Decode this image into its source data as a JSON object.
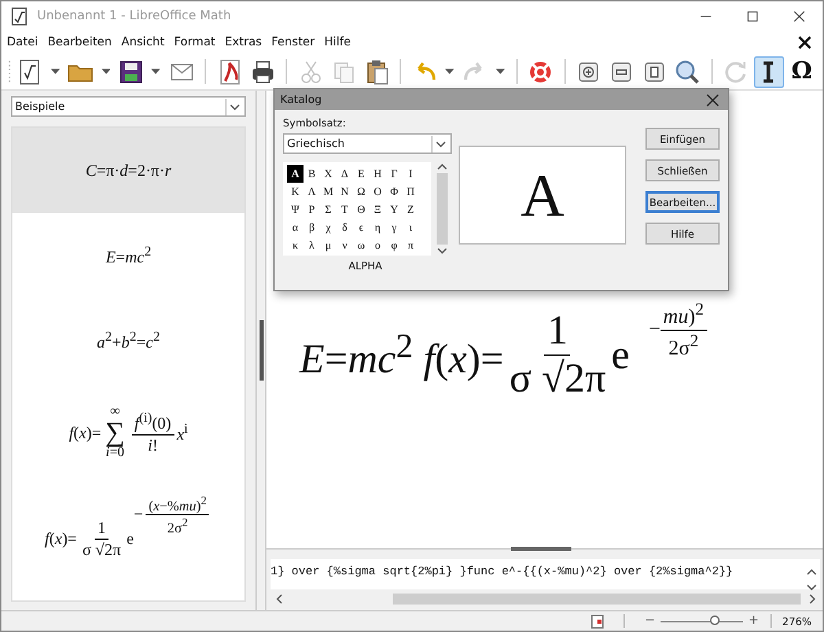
{
  "window": {
    "title": "Unbenannt 1 - LibreOffice Math"
  },
  "menu": [
    {
      "label": "Datei"
    },
    {
      "label": "Bearbeiten"
    },
    {
      "label": "Ansicht"
    },
    {
      "label": "Format"
    },
    {
      "label": "Extras"
    },
    {
      "label": "Fenster"
    },
    {
      "label": "Hilfe"
    }
  ],
  "toolbar": [
    [
      {
        "kind": "new",
        "menu": true,
        "disabled": false,
        "on": false
      },
      {
        "kind": "open",
        "menu": true,
        "disabled": false,
        "on": false
      },
      {
        "kind": "save",
        "menu": true,
        "disabled": false,
        "on": false
      },
      {
        "kind": "mail",
        "menu": false,
        "disabled": false,
        "on": false
      }
    ],
    [
      {
        "kind": "pdf",
        "menu": false,
        "disabled": false,
        "on": false
      },
      {
        "kind": "print",
        "menu": false,
        "disabled": false,
        "on": false
      }
    ],
    [
      {
        "kind": "cut",
        "menu": false,
        "disabled": true,
        "on": false
      },
      {
        "kind": "copy",
        "menu": false,
        "disabled": true,
        "on": false
      },
      {
        "kind": "paste",
        "menu": false,
        "disabled": false,
        "on": false
      }
    ],
    [
      {
        "kind": "undo",
        "menu": true,
        "disabled": false,
        "on": false
      },
      {
        "kind": "redo",
        "menu": true,
        "disabled": true,
        "on": false
      }
    ],
    [
      {
        "kind": "help",
        "menu": false,
        "disabled": false,
        "on": false
      }
    ],
    [
      {
        "kind": "zoom_in",
        "menu": false,
        "disabled": false,
        "on": false
      },
      {
        "kind": "zoom_out",
        "menu": false,
        "disabled": false,
        "on": false
      },
      {
        "kind": "zoom_page",
        "menu": false,
        "disabled": false,
        "on": false
      },
      {
        "kind": "show_all",
        "menu": false,
        "disabled": false,
        "on": false
      }
    ],
    [
      {
        "kind": "update",
        "menu": false,
        "disabled": true,
        "on": false
      },
      {
        "kind": "cursor",
        "menu": false,
        "disabled": false,
        "on": true
      },
      {
        "kind": "symbols",
        "menu": false,
        "disabled": false,
        "on": false,
        "label": "Ω"
      }
    ]
  ],
  "sidebar": {
    "dropdown": {
      "value": "Beispiele"
    },
    "items": [
      {
        "kind": "inline",
        "selected": true,
        "text": "*C*=π·*d*=2·π·*r*"
      },
      {
        "kind": "inline",
        "selected": false,
        "text": "*E*=*mc*$^{2}$"
      },
      {
        "kind": "inline",
        "selected": false,
        "text": "*a*$^{2}$+*b*$^{2}$=*c*$^{2}$"
      },
      {
        "kind": "series",
        "selected": false,
        "lhs": "*f*(*x*)=",
        "upper": "∞",
        "operator": "∑",
        "lower": "*i*=0",
        "numerator": "*f*$^{(i)}$(0)",
        "denominator": "*i*!",
        "tail": "*x*$^{i}$"
      },
      {
        "kind": "gauss",
        "selected": false,
        "lhs": "*f*(*x*)=",
        "numerator": "1",
        "denominator": "σ √2π",
        "base": "e",
        "exponent_sign": "−",
        "exponent_numerator": "(*x*−%*mu*)$^{2}$",
        "exponent_denominator": "2σ$^{2}$"
      }
    ]
  },
  "document": {
    "lhs": "*E*=*mc*$^{2}$ *f*(*x*)=",
    "numerator": "1",
    "denominator": "σ √2π",
    "base": "e",
    "exponent_sign": "−",
    "exponent_numerator": "*mu*)$^{2}$",
    "exponent_denominator": "2σ$^{2}$"
  },
  "dialog": {
    "title": "Katalog",
    "set_label": "Symbolsatz:",
    "set_value": "Griechisch",
    "symbols": [
      {
        "char": "Α",
        "selected": true
      },
      {
        "char": "Β",
        "selected": false
      },
      {
        "char": "Χ",
        "selected": false
      },
      {
        "char": "Δ",
        "selected": false
      },
      {
        "char": "Ε",
        "selected": false
      },
      {
        "char": "Η",
        "selected": false
      },
      {
        "char": "Γ",
        "selected": false
      },
      {
        "char": "Ι",
        "selected": false
      },
      {
        "char": "Κ",
        "selected": false
      },
      {
        "char": "Λ",
        "selected": false
      },
      {
        "char": "Μ",
        "selected": false
      },
      {
        "char": "Ν",
        "selected": false
      },
      {
        "char": "Ω",
        "selected": false
      },
      {
        "char": "Ο",
        "selected": false
      },
      {
        "char": "Φ",
        "selected": false
      },
      {
        "char": "Π",
        "selected": false
      },
      {
        "char": "Ψ",
        "selected": false
      },
      {
        "char": "Ρ",
        "selected": false
      },
      {
        "char": "Σ",
        "selected": false
      },
      {
        "char": "Τ",
        "selected": false
      },
      {
        "char": "Θ",
        "selected": false
      },
      {
        "char": "Ξ",
        "selected": false
      },
      {
        "char": "Υ",
        "selected": false
      },
      {
        "char": "Ζ",
        "selected": false
      },
      {
        "char": "α",
        "selected": false
      },
      {
        "char": "β",
        "selected": false
      },
      {
        "char": "χ",
        "selected": false
      },
      {
        "char": "δ",
        "selected": false
      },
      {
        "char": "ϵ",
        "selected": false
      },
      {
        "char": "η",
        "selected": false
      },
      {
        "char": "γ",
        "selected": false
      },
      {
        "char": "ι",
        "selected": false
      },
      {
        "char": "κ",
        "selected": false
      },
      {
        "char": "λ",
        "selected": false
      },
      {
        "char": "μ",
        "selected": false
      },
      {
        "char": "ν",
        "selected": false
      },
      {
        "char": "ω",
        "selected": false
      },
      {
        "char": "ο",
        "selected": false
      },
      {
        "char": "φ",
        "selected": false
      },
      {
        "char": "π",
        "selected": false
      }
    ],
    "symbol_name": "ALPHA",
    "preview": "Α",
    "buttons": [
      {
        "label": "Einfügen",
        "focused": false
      },
      {
        "label": "Schließen",
        "focused": false
      },
      {
        "label": "Bearbeiten...",
        "focused": true
      },
      {
        "label": "Hilfe",
        "focused": false
      }
    ]
  },
  "command": {
    "text": "1} over {%sigma sqrt{2%pi} }func e^-{{(x-%mu)^2} over {2%sigma^2}}"
  },
  "status_bar": {
    "zoom_out": "−",
    "zoom_in": "+",
    "zoom": {
      "level": 0.67
    },
    "zoom_reading": "276%"
  }
}
